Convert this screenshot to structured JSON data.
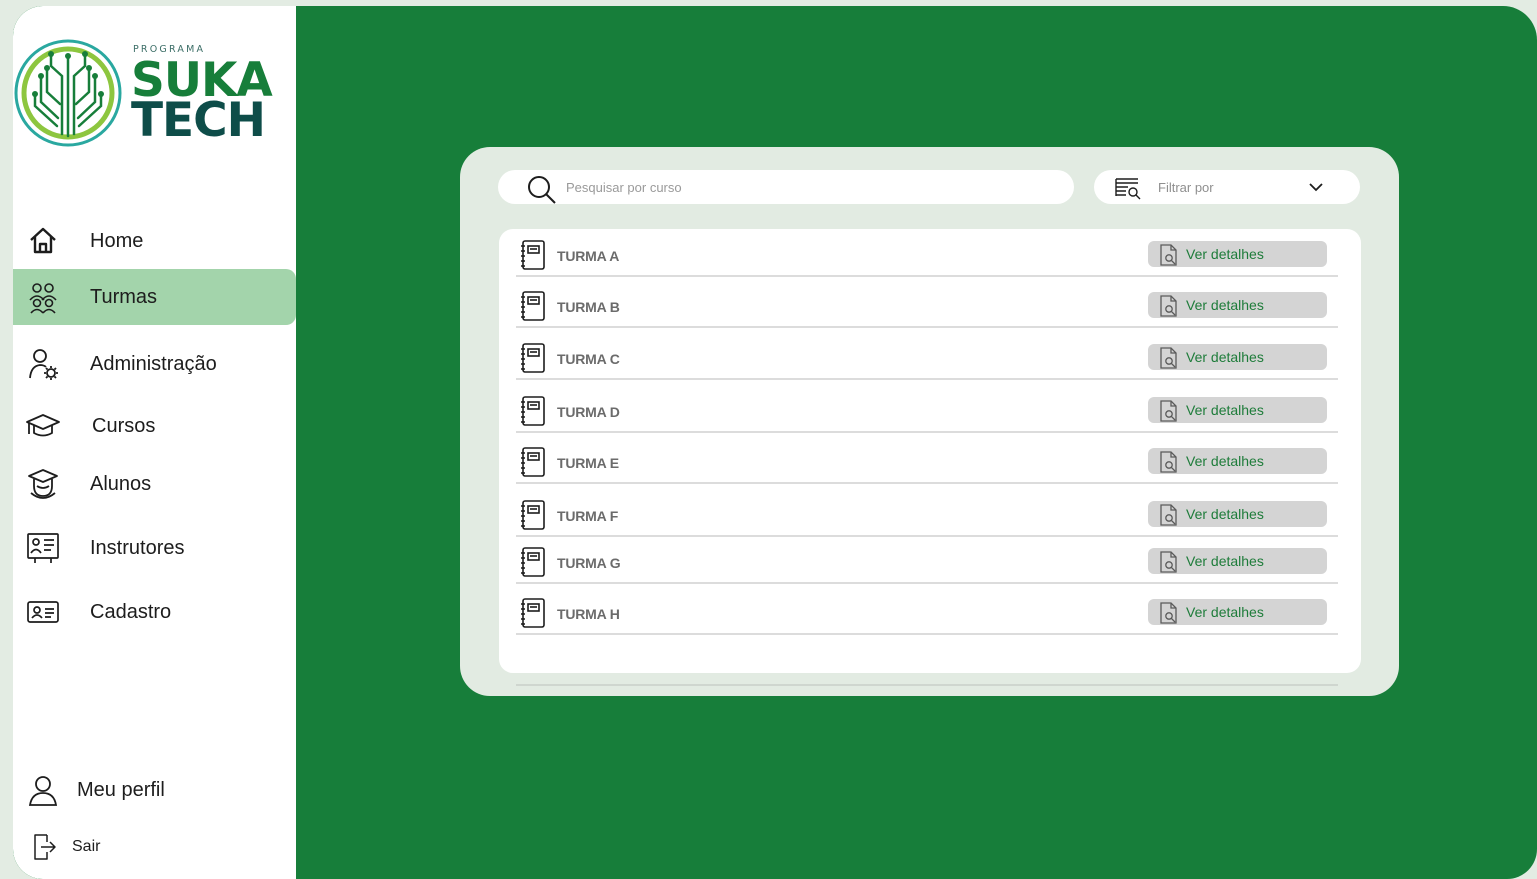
{
  "brand": {
    "program_label": "PROGRAMA",
    "line1": "SUKA",
    "line2": "TECH"
  },
  "sidebar": {
    "items": [
      {
        "label": "Home",
        "icon": "home-icon",
        "active": false
      },
      {
        "label": "Turmas",
        "icon": "users-group-icon",
        "active": true
      },
      {
        "label": "Administração",
        "icon": "user-gear-icon",
        "active": false
      },
      {
        "label": "Cursos",
        "icon": "graduation-cap-icon",
        "active": false
      },
      {
        "label": "Alunos",
        "icon": "student-icon",
        "active": false
      },
      {
        "label": "Instrutores",
        "icon": "instructor-board-icon",
        "active": false
      },
      {
        "label": "Cadastro",
        "icon": "id-card-icon",
        "active": false
      }
    ],
    "profile_label": "Meu perfil",
    "logout_label": "Sair"
  },
  "search": {
    "placeholder": "Pesquisar por curso"
  },
  "filter": {
    "label": "Filtrar por"
  },
  "classes": [
    {
      "name": "TURMA A",
      "action": "Ver detalhes"
    },
    {
      "name": "TURMA B",
      "action": "Ver detalhes"
    },
    {
      "name": "TURMA C",
      "action": "Ver detalhes"
    },
    {
      "name": "TURMA D",
      "action": "Ver detalhes"
    },
    {
      "name": "TURMA E",
      "action": "Ver detalhes"
    },
    {
      "name": "TURMA F",
      "action": "Ver detalhes"
    },
    {
      "name": "TURMA G",
      "action": "Ver detalhes"
    },
    {
      "name": "TURMA H",
      "action": "Ver detalhes"
    }
  ],
  "colors": {
    "primary_green": "#177e3a",
    "active_nav": "#a3d4ab",
    "panel_bg": "#e2ebe2",
    "logo_teal": "#0e4d49"
  }
}
